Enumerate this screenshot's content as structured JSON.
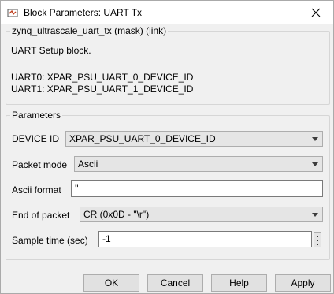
{
  "window": {
    "title": "Block Parameters: UART Tx",
    "icon": "simulink-block-icon",
    "close_icon": "close-icon"
  },
  "mask": {
    "legend": "zynq_ultrascale_uart_tx (mask) (link)",
    "description": "UART Setup block.",
    "lines": [
      "UART0: XPAR_PSU_UART_0_DEVICE_ID",
      "UART1: XPAR_PSU_UART_1_DEVICE_ID"
    ]
  },
  "parameters": {
    "legend": "Parameters",
    "device_id": {
      "label": "DEVICE ID",
      "value": "XPAR_PSU_UART_0_DEVICE_ID"
    },
    "packet_mode": {
      "label": "Packet mode",
      "value": "Ascii"
    },
    "ascii_format": {
      "label": "Ascii format",
      "value": "''"
    },
    "end_of_packet": {
      "label": "End of packet",
      "value": "CR (0x0D - \"\\r\")"
    },
    "sample_time": {
      "label": "Sample time (sec)",
      "value": "-1"
    }
  },
  "buttons": {
    "ok": "OK",
    "cancel": "Cancel",
    "help": "Help",
    "apply": "Apply"
  },
  "colors": {
    "background": "#f0f0f0",
    "title_bar": "#ffffff",
    "border": "#adadad"
  }
}
